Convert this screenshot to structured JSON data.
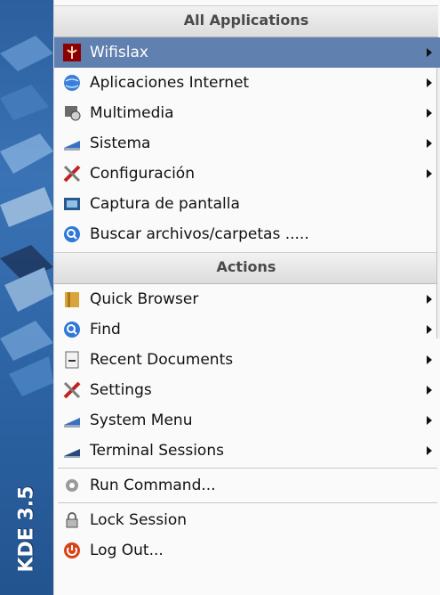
{
  "sidebar": {
    "label": "KDE 3.5"
  },
  "sections": {
    "all_applications": "All Applications",
    "actions": "Actions"
  },
  "apps": [
    {
      "label": "Wifislax",
      "icon": "wifislax-icon",
      "submenu": true,
      "selected": true
    },
    {
      "label": "Aplicaciones Internet",
      "icon": "globe-icon",
      "submenu": true
    },
    {
      "label": "Multimedia",
      "icon": "multimedia-icon",
      "submenu": true
    },
    {
      "label": "Sistema",
      "icon": "system-monitor-icon",
      "submenu": true
    },
    {
      "label": "Configuración",
      "icon": "tools-icon",
      "submenu": true
    },
    {
      "label": "Captura de pantalla",
      "icon": "camera-icon",
      "submenu": false
    },
    {
      "label": "Buscar archivos/carpetas .....",
      "icon": "search-icon",
      "submenu": false
    }
  ],
  "actions": [
    {
      "label": "Quick Browser",
      "icon": "folder-icon",
      "submenu": true
    },
    {
      "label": "Find",
      "icon": "search-icon",
      "submenu": true
    },
    {
      "label": "Recent Documents",
      "icon": "document-icon",
      "submenu": true
    },
    {
      "label": "Settings",
      "icon": "tools-icon",
      "submenu": true
    },
    {
      "label": "System Menu",
      "icon": "system-monitor-icon",
      "submenu": true
    },
    {
      "label": "Terminal Sessions",
      "icon": "terminal-icon",
      "submenu": true
    }
  ],
  "footer": [
    {
      "label": "Run Command...",
      "icon": "gear-icon"
    },
    {
      "label": "Lock Session",
      "icon": "lock-icon"
    },
    {
      "label": "Log Out...",
      "icon": "logout-icon"
    }
  ],
  "colors": {
    "selected_bg": "#6080b0",
    "sidebar": "#2e65a6"
  }
}
